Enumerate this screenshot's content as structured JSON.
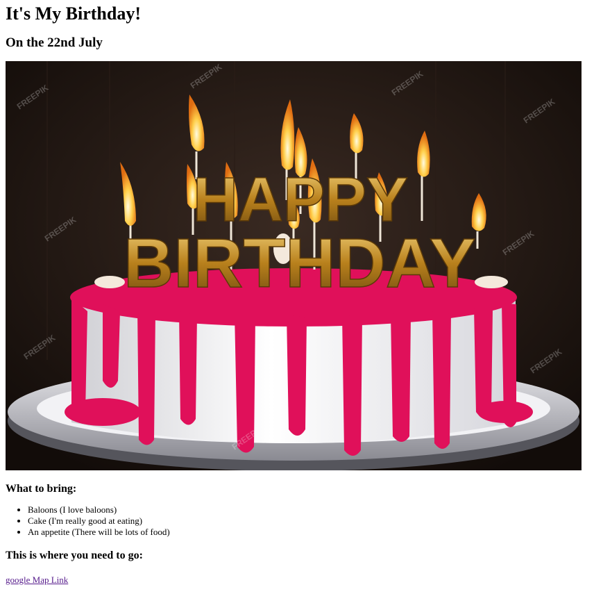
{
  "page": {
    "title": "It's My Birthday!",
    "date_heading": "On the 22nd July",
    "image": {
      "candle_text_top": "HAPPY",
      "candle_text_bottom": "BIRTHDAY",
      "watermark": "FREEPIK"
    },
    "bring_heading": "What to bring:",
    "bring_items": [
      "Baloons (I love baloons)",
      "Cake (I'm really good at eating)",
      "An appetite (There will be lots of food)"
    ],
    "location_heading": "This is where you need to go:",
    "map_link_label": "google Map Link"
  },
  "colors": {
    "link": "#551a8b",
    "icing": "#e0105a",
    "gold": "#c9962a",
    "background_dark": "#1c1410"
  }
}
